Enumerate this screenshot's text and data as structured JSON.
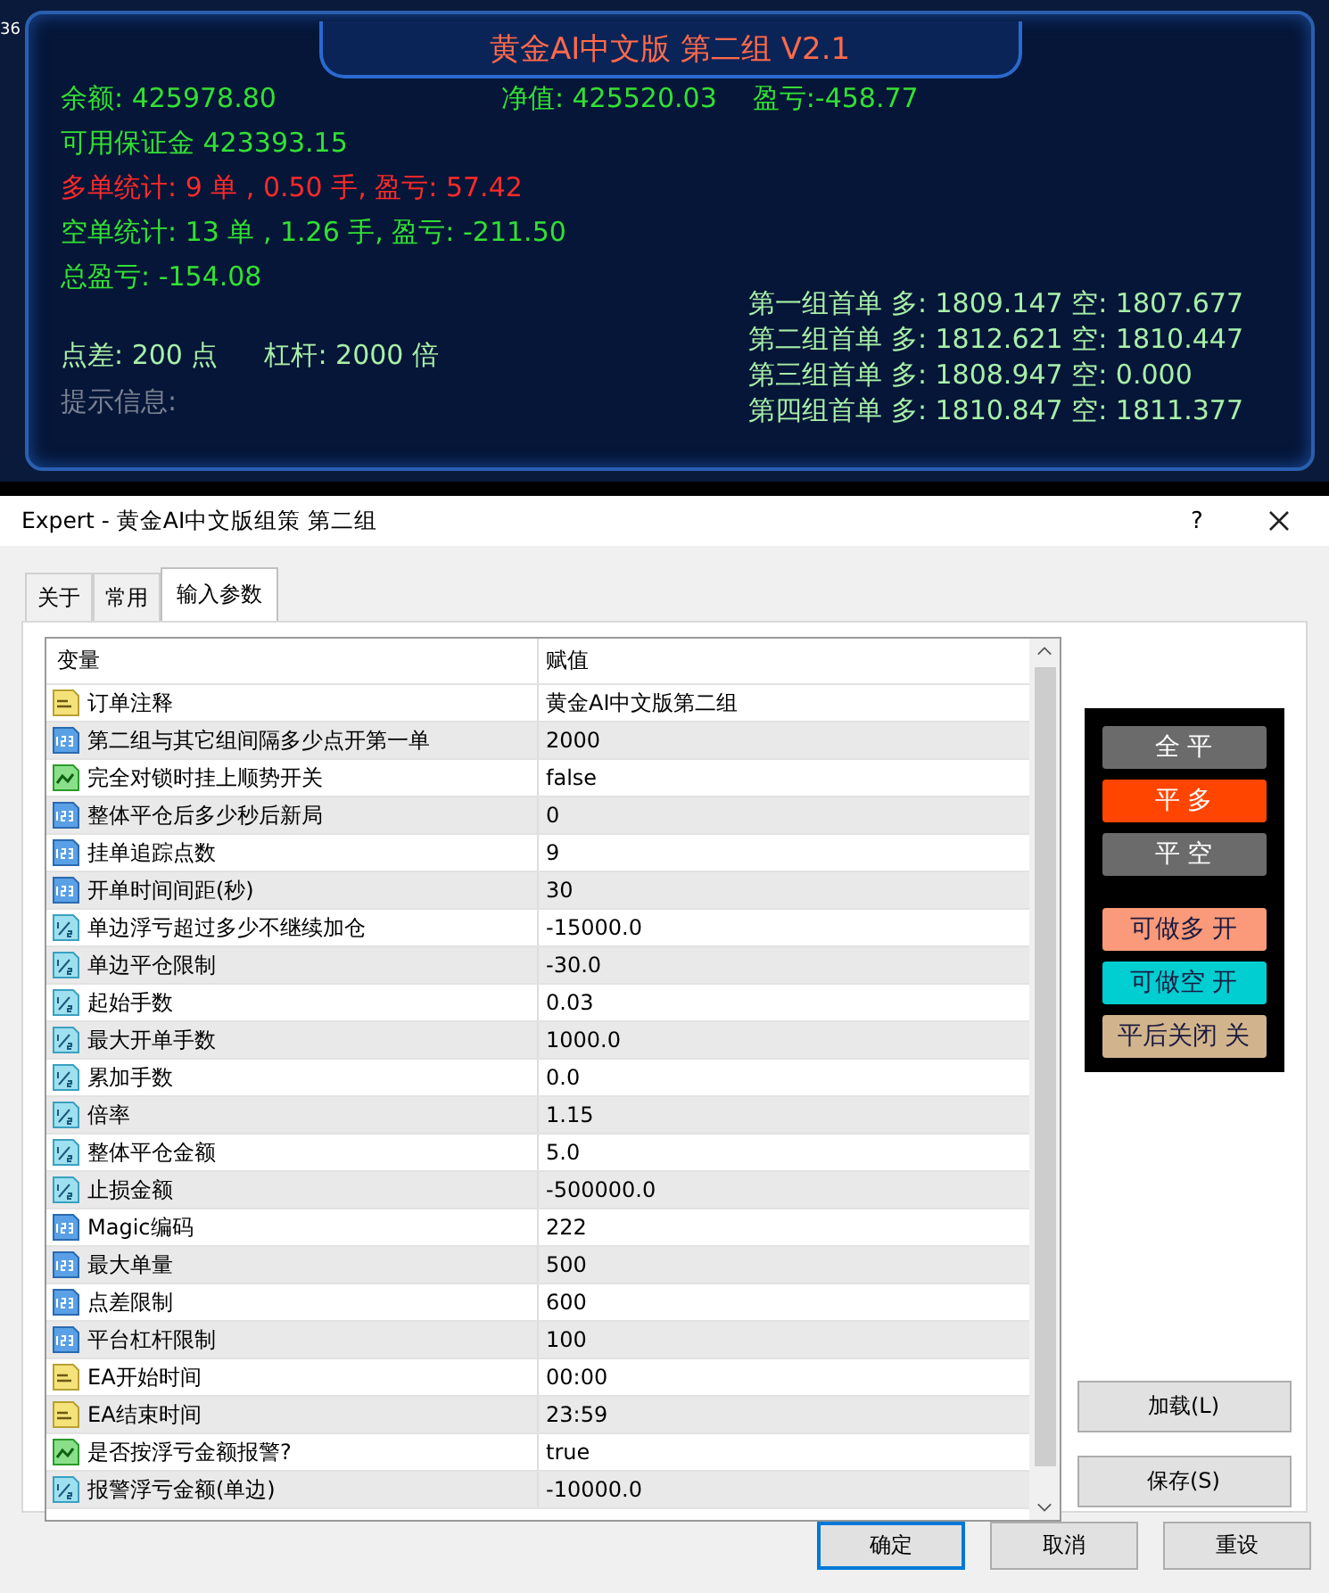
{
  "chart_edge": {
    "label": "36"
  },
  "panel": {
    "title": "黄金AI中文版 第二组 V2.1",
    "lines_left": [
      {
        "kind": "normal",
        "text": "余额: 425978.80"
      },
      {
        "kind": "normal",
        "text": "可用保证金 423393.15"
      },
      {
        "kind": "alert",
        "text": "多单统计: 9 单 , 0.50 手, 盈亏: 57.42"
      },
      {
        "kind": "normal",
        "text": "空单统计: 13 单 , 1.26 手, 盈亏: -211.50"
      },
      {
        "kind": "normal",
        "text": "总盈亏: -154.08"
      }
    ],
    "equity": "净值: 425520.03",
    "profit": "盈亏:-458.77",
    "groups": [
      "第一组首单 多: 1809.147 空: 1807.677",
      "第二组首单 多: 1812.621 空: 1810.447",
      "第三组首单 多: 1808.947 空: 0.000",
      "第四组首单 多: 1810.847 空: 1811.377"
    ],
    "spread": "点差: 200 点",
    "leverage": "杠杆: 2000 倍",
    "hint": "提示信息:"
  },
  "dialog": {
    "title": "Expert - 黄金AI中文版组策 第二组",
    "help": "?",
    "tabs": [
      {
        "label": "关于",
        "selected": false
      },
      {
        "label": "常用",
        "selected": false
      },
      {
        "label": "输入参数",
        "selected": true
      }
    ],
    "table": {
      "columns": [
        "变量",
        "赋值"
      ],
      "rows": [
        {
          "kind": "text",
          "name": "订单注释",
          "value": "黄金AI中文版第二组"
        },
        {
          "kind": "int",
          "name": "第二组与其它组间隔多少点开第一单",
          "value": "2000"
        },
        {
          "kind": "bool",
          "name": "完全对锁时挂上顺势开关",
          "value": "false"
        },
        {
          "kind": "int",
          "name": "整体平仓后多少秒后新局",
          "value": "0"
        },
        {
          "kind": "int",
          "name": "挂单追踪点数",
          "value": "9"
        },
        {
          "kind": "int",
          "name": "开单时间间距(秒)",
          "value": "30"
        },
        {
          "kind": "double",
          "name": "单边浮亏超过多少不继续加仓",
          "value": "-15000.0"
        },
        {
          "kind": "double",
          "name": "单边平仓限制",
          "value": "-30.0"
        },
        {
          "kind": "double",
          "name": "起始手数",
          "value": "0.03"
        },
        {
          "kind": "double",
          "name": "最大开单手数",
          "value": "1000.0"
        },
        {
          "kind": "double",
          "name": "累加手数",
          "value": "0.0"
        },
        {
          "kind": "double",
          "name": "倍率",
          "value": "1.15"
        },
        {
          "kind": "double",
          "name": "整体平仓金额",
          "value": "5.0"
        },
        {
          "kind": "double",
          "name": "止损金额",
          "value": "-500000.0"
        },
        {
          "kind": "int",
          "name": "Magic编码",
          "value": "222"
        },
        {
          "kind": "int",
          "name": "最大单量",
          "value": "500"
        },
        {
          "kind": "int",
          "name": "点差限制",
          "value": "600"
        },
        {
          "kind": "int",
          "name": "平台杠杆限制",
          "value": "100"
        },
        {
          "kind": "text",
          "name": "EA开始时间",
          "value": "00:00"
        },
        {
          "kind": "text",
          "name": "EA结束时间",
          "value": "23:59"
        },
        {
          "kind": "bool",
          "name": "是否按浮亏金额报警?",
          "value": "true"
        },
        {
          "kind": "double",
          "name": "报警浮亏金额(单边)",
          "value": "-10000.0"
        }
      ]
    },
    "controls": [
      {
        "label": "全 平",
        "color": "#6b6b6b"
      },
      {
        "label": "平 多",
        "color": "#ff4500"
      },
      {
        "label": "平 空",
        "color": "#6b6b6b"
      },
      {
        "label": "可做多 开",
        "color": "#fa9a7a"
      },
      {
        "label": "可做空 开",
        "color": "#00ced1"
      },
      {
        "label": "平后关闭 关",
        "color": "#d2b48c"
      }
    ],
    "side_buttons": [
      "加载(L)",
      "保存(S)"
    ],
    "buttons": [
      {
        "label": "确定",
        "default": true
      },
      {
        "label": "取消",
        "default": false
      },
      {
        "label": "重设",
        "default": false
      }
    ]
  }
}
